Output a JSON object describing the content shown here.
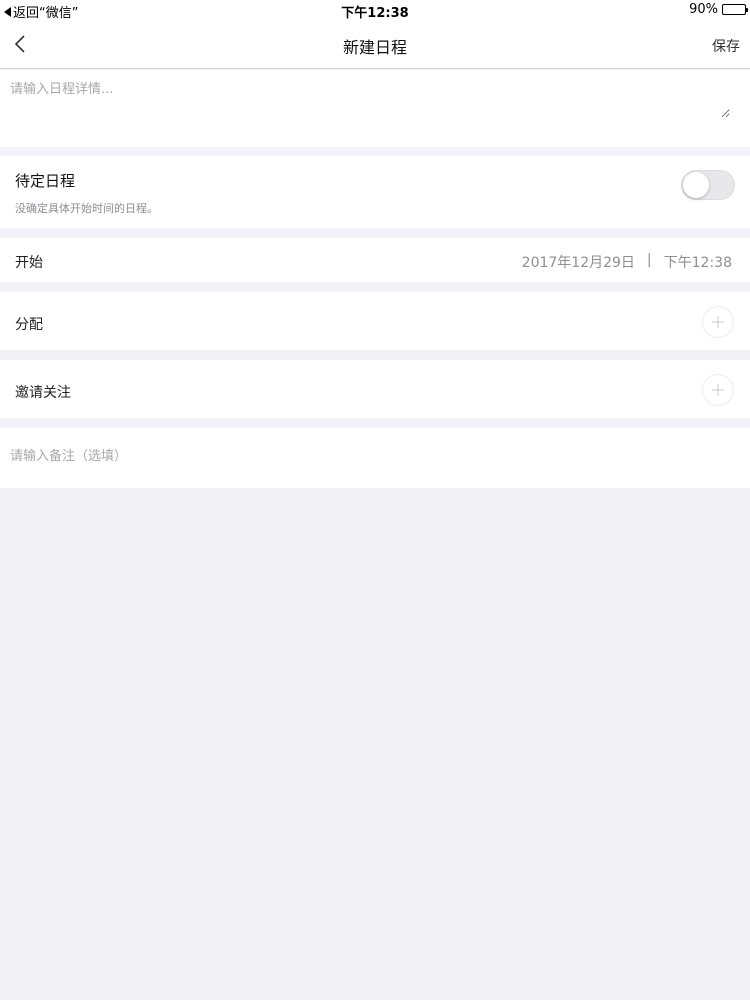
{
  "status_bar": {
    "back_app": "返回“微信”",
    "time": "下午12:38",
    "battery_text": "90%",
    "battery_level": 0.9
  },
  "nav": {
    "title": "新建日程",
    "save_label": "保存"
  },
  "detail": {
    "placeholder": "请输入日程详情..."
  },
  "pending": {
    "title": "待定日程",
    "description": "没确定具体开始时间的日程。",
    "toggle_on": false
  },
  "start": {
    "label": "开始",
    "date": "2017年12月29日",
    "separator": "|",
    "time": "下午12:38"
  },
  "assign": {
    "label": "分配"
  },
  "invite": {
    "label": "邀请关注"
  },
  "note": {
    "placeholder": "请输入备注（选填）"
  },
  "colors": {
    "background": "#f3f2f6",
    "secondary_text": "#8e8e93"
  }
}
